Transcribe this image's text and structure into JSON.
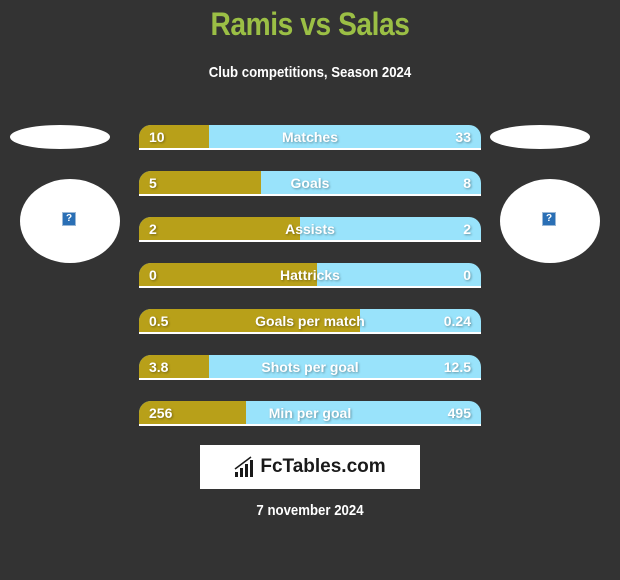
{
  "header": {
    "title": "Ramis vs Salas",
    "subtitle": "Club competitions, Season 2024"
  },
  "colors": {
    "title": "#9bbf45",
    "left_player": "#b8a019",
    "right_player": "#99e3fb",
    "background": "#333333"
  },
  "players": {
    "left": {
      "name": "Ramis",
      "logo_icon": "image-placeholder-icon"
    },
    "right": {
      "name": "Salas",
      "logo_icon": "image-placeholder-icon"
    }
  },
  "stats": [
    {
      "label": "Matches",
      "left": "10",
      "right": "33",
      "left_share": 0.205
    },
    {
      "label": "Goals",
      "left": "5",
      "right": "8",
      "left_share": 0.357
    },
    {
      "label": "Assists",
      "left": "2",
      "right": "2",
      "left_share": 0.47
    },
    {
      "label": "Hattricks",
      "left": "0",
      "right": "0",
      "left_share": 0.52
    },
    {
      "label": "Goals per match",
      "left": "0.5",
      "right": "0.24",
      "left_share": 0.645
    },
    {
      "label": "Shots per goal",
      "left": "3.8",
      "right": "12.5",
      "left_share": 0.205
    },
    {
      "label": "Min per goal",
      "left": "256",
      "right": "495",
      "left_share": 0.313
    }
  ],
  "brand": {
    "name": "FcTables.com",
    "icon": "bar-chart-icon"
  },
  "footer": {
    "date": "7 november 2024"
  }
}
